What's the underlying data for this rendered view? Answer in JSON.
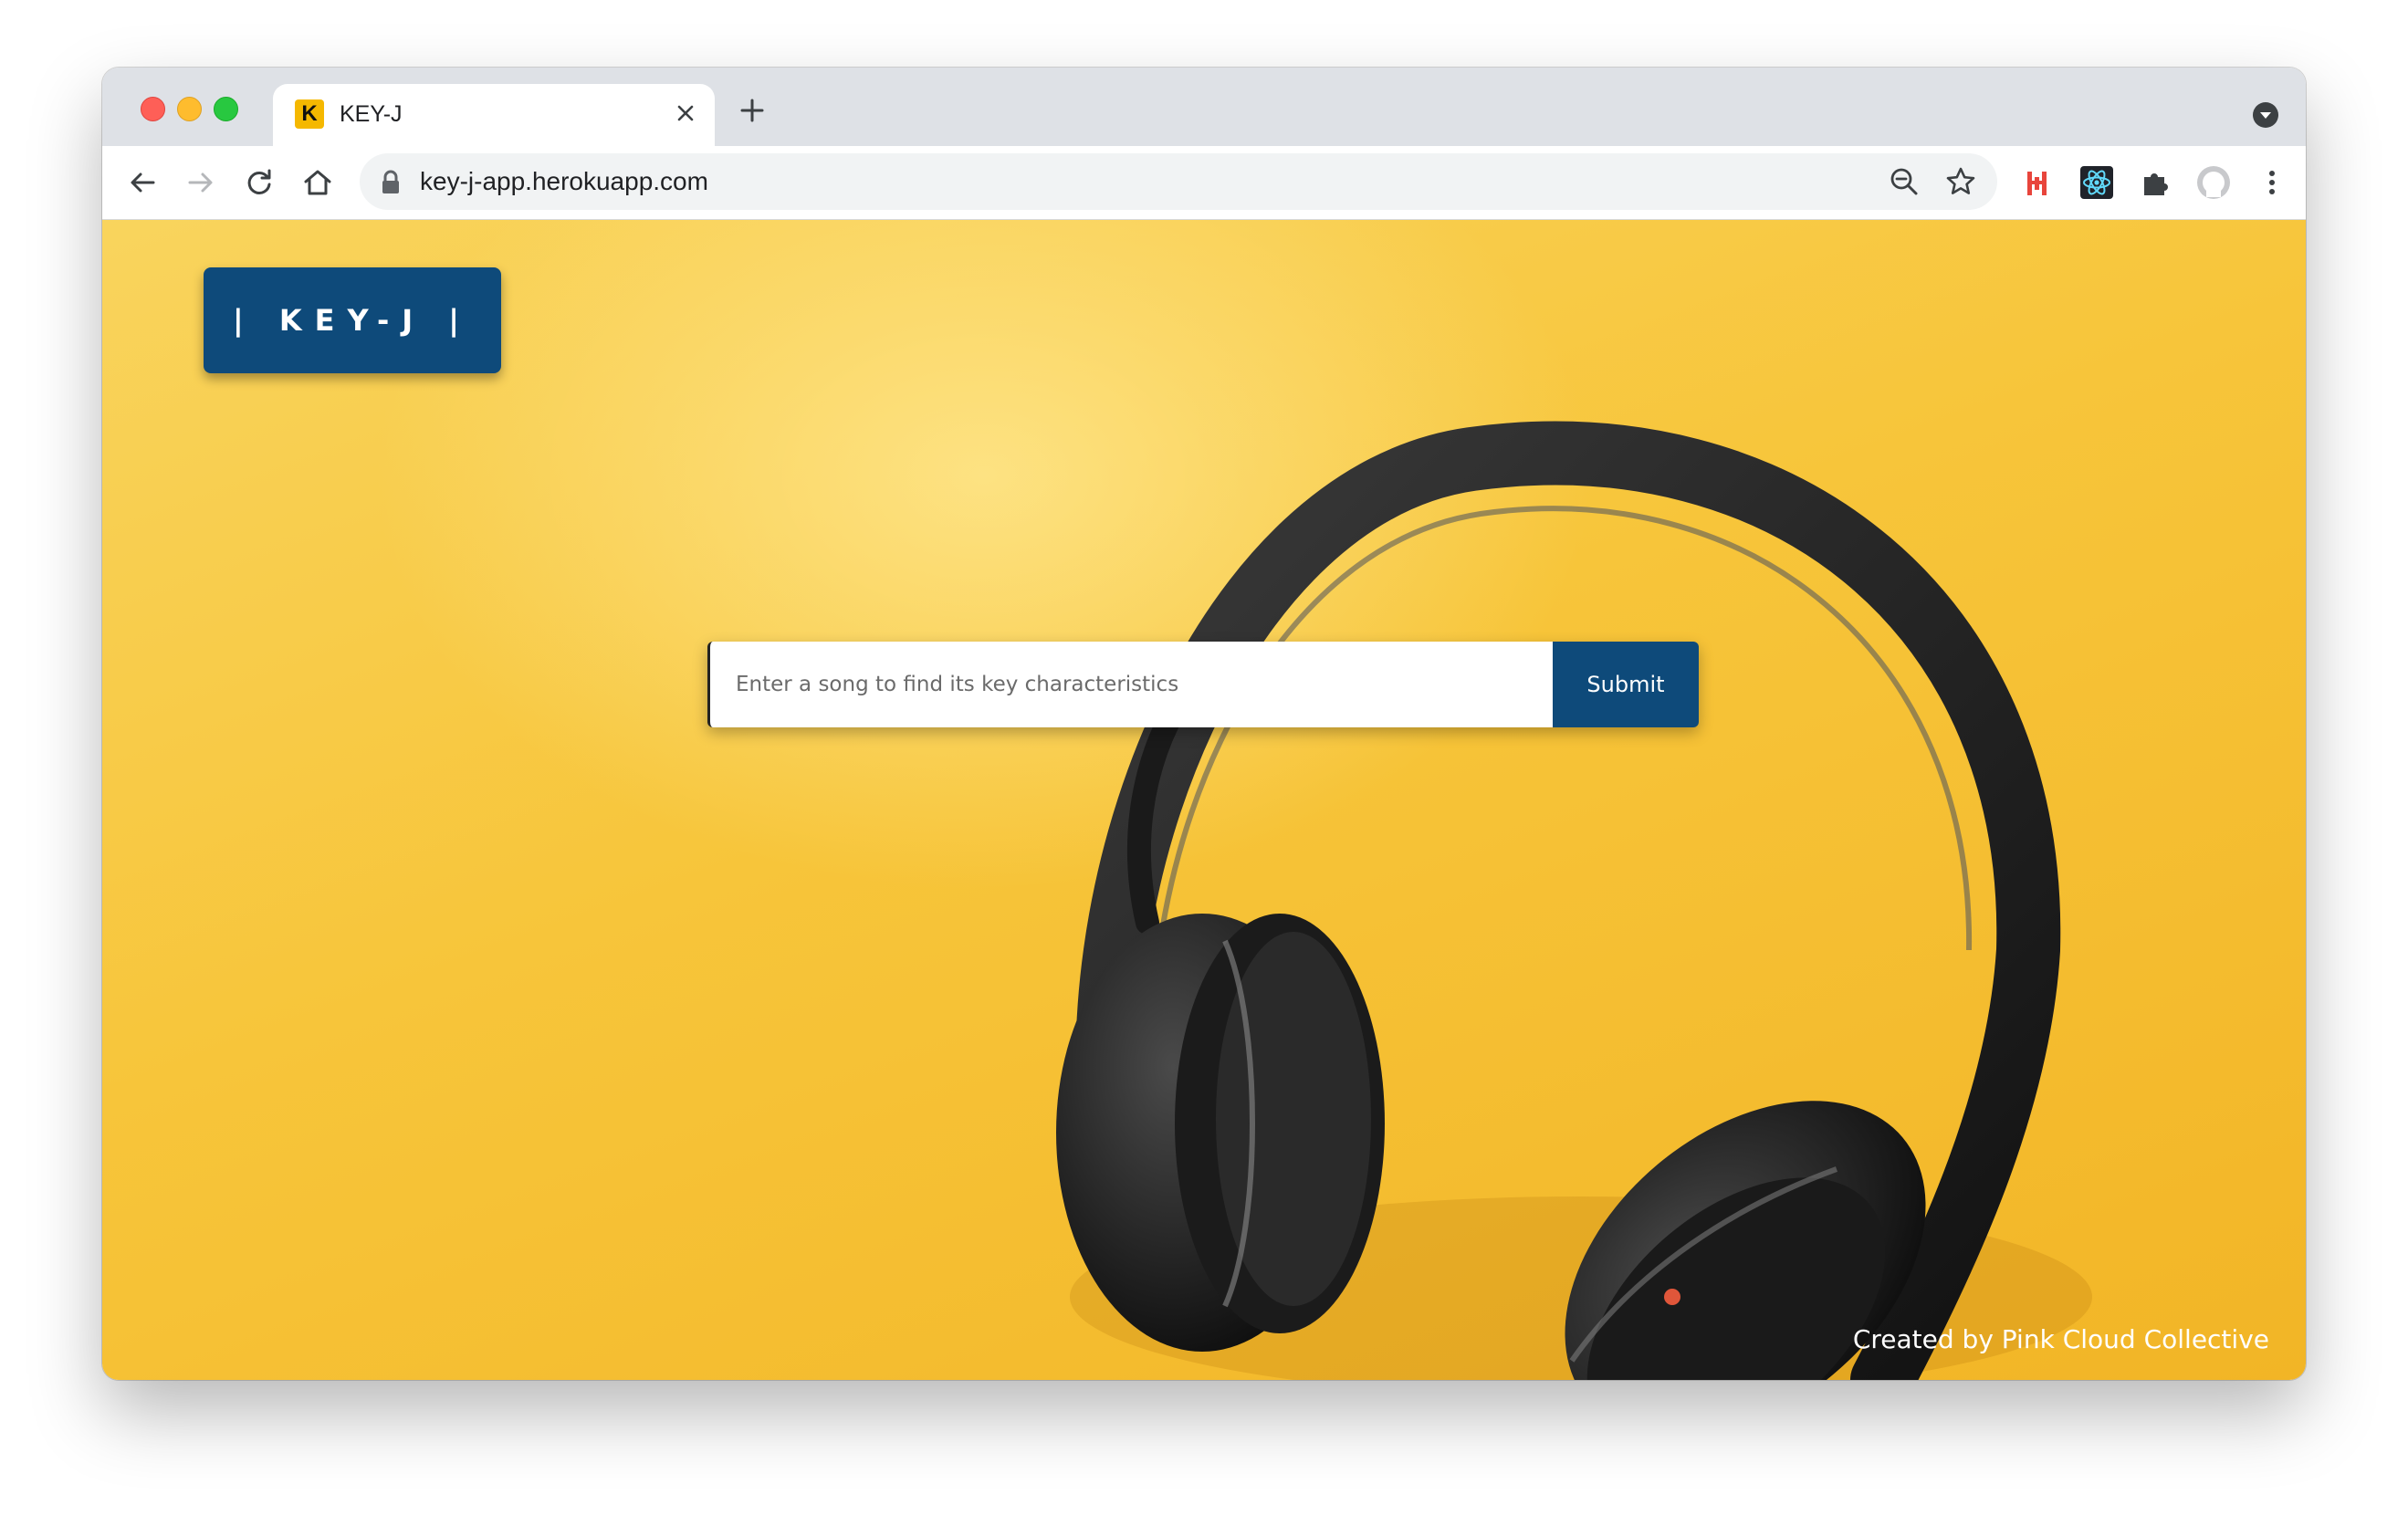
{
  "browser": {
    "tab_title": "KEY-J",
    "favicon_letter": "K",
    "url": "key-j-app.herokuapp.com"
  },
  "app": {
    "logo_text": "| KEY-J |",
    "search_placeholder": "Enter a song to find its key characteristics",
    "submit_label": "Submit",
    "footer_credit": "Created by Pink Cloud Collective"
  },
  "colors": {
    "brand": "#0e4a7a",
    "background": "#f7c53a"
  }
}
